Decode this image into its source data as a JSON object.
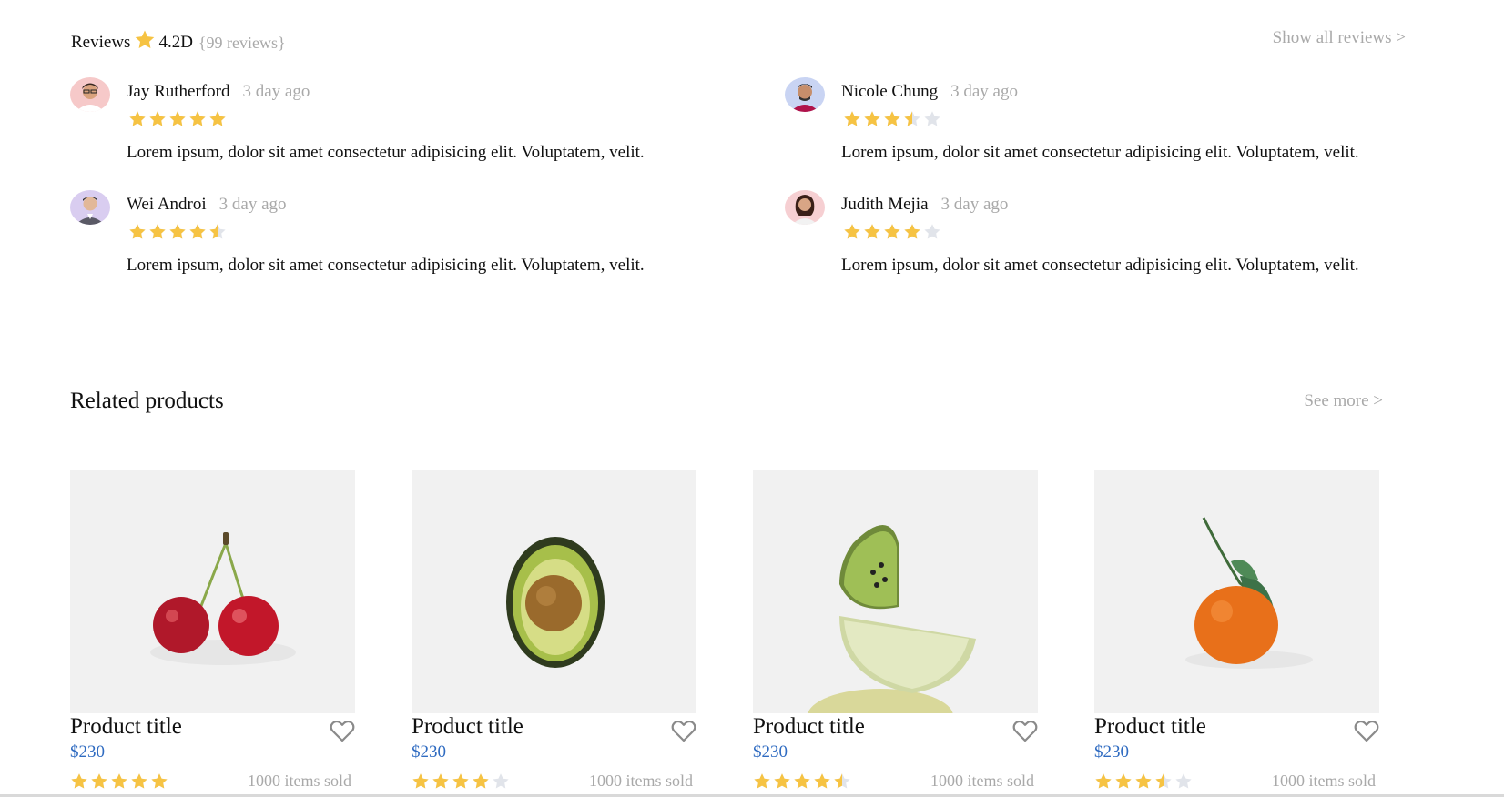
{
  "reviews_section": {
    "label": "Reviews",
    "rating": "4.2D",
    "count_text": "{99 reviews}",
    "show_all": "Show all reviews >"
  },
  "reviews": [
    {
      "name": "Jay Rutherford",
      "time": "3 day ago",
      "rating": 5,
      "text": "Lorem ipsum, dolor sit amet consectetur adipisicing elit. Voluptatem, velit.",
      "avatar_bg": "#f6c9c9"
    },
    {
      "name": "Nicole Chung",
      "time": "3 day ago",
      "rating": 3.5,
      "text": "Lorem ipsum, dolor sit amet consectetur adipisicing elit. Voluptatem, velit.",
      "avatar_bg": "#c9d4f3"
    },
    {
      "name": "Wei Androi",
      "time": "3 day ago",
      "rating": 4.5,
      "text": "Lorem ipsum, dolor sit amet consectetur adipisicing elit. Voluptatem, velit.",
      "avatar_bg": "#d9cdf0"
    },
    {
      "name": "Judith Mejia",
      "time": "3 day ago",
      "rating": 4,
      "text": "Lorem ipsum, dolor sit amet consectetur adipisicing elit. Voluptatem, velit.",
      "avatar_bg": "#f6cfd2"
    }
  ],
  "related": {
    "title": "Related products",
    "see_more": "See more >"
  },
  "products": [
    {
      "title": "Product title",
      "price": "$230",
      "rating": 5,
      "sold": "1000 items sold",
      "image": "cherries"
    },
    {
      "title": "Product title",
      "price": "$230",
      "rating": 4,
      "sold": "1000 items sold",
      "image": "avocado"
    },
    {
      "title": "Product title",
      "price": "$230",
      "rating": 4.5,
      "sold": "1000 items sold",
      "image": "kiwi-lime"
    },
    {
      "title": "Product title",
      "price": "$230",
      "rating": 3.5,
      "sold": "1000 items sold",
      "image": "tangerine"
    }
  ],
  "colors": {
    "star": "#f6c343",
    "star_empty": "#e1e4ea",
    "price": "#2f6bc1",
    "muted": "#a9a9a9"
  }
}
